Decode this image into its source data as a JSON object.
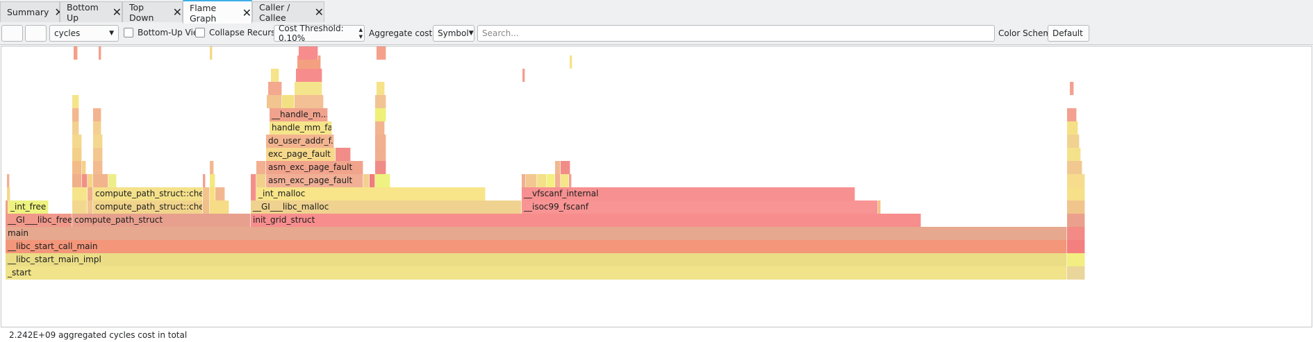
{
  "tabs": [
    {
      "label": "Summary",
      "active": false
    },
    {
      "label": "Bottom Up",
      "active": false
    },
    {
      "label": "Top Down",
      "active": false
    },
    {
      "label": "Flame Graph",
      "active": true
    },
    {
      "label": "Caller / Callee",
      "active": false
    }
  ],
  "toolbar": {
    "event_type": "cycles",
    "bottom_up_view": "Bottom-Up View",
    "collapse_recursion": "Collapse Recursion",
    "cost_threshold": "Cost Threshold: 0.10%",
    "aggregate_label": "Aggregate cost by:",
    "aggregate_value": "Symbol",
    "search_placeholder": "Search...",
    "color_scheme_label": "Color Scheme:",
    "color_scheme_value": "Default"
  },
  "flame": {
    "labels": {
      "start": "_start",
      "libc_start_main_impl": "__libc_start_main_impl",
      "libc_start_call_main": "__libc_start_call_main",
      "main": "main",
      "gi_libc_free": "__GI___libc_free",
      "compute_path_struct": "compute_path_struct",
      "init_grid_struct": "init_grid_struct",
      "int_free": "_int_free",
      "compute_path_check_1": "compute_path_struct::chec...",
      "compute_path_check_2": "compute_path_struct::chec...",
      "gi_libc_malloc": "__GI___libc_malloc",
      "int_malloc": "_int_malloc",
      "isoc99_fscanf": "__isoc99_fscanf",
      "vfscanf_internal": "__vfscanf_internal",
      "asm_exc_page_fault_1": "asm_exc_page_fault",
      "asm_exc_page_fault_2": "asm_exc_page_fault",
      "exc_page_fault": "exc_page_fault",
      "do_user_addr_fault": "do_user_addr_f...",
      "handle_mm_fault": "handle_mm_fa...",
      "handle_mm_fault_2": "__handle_m..."
    }
  },
  "status": {
    "total": "2.242E+09 aggregated cycles cost in total"
  }
}
